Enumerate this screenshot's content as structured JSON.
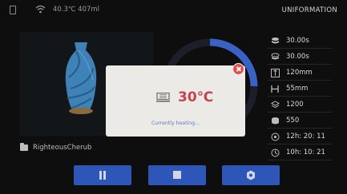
{
  "status_bar": {
    "status_text": "40.3℃ 407ml",
    "logo": "UNIFORMATION"
  },
  "stats": [
    {
      "icon": "layer-time-icon",
      "value": "30.00s"
    },
    {
      "icon": "layer-time-icon",
      "value": "30.00s"
    },
    {
      "icon": "height-icon",
      "value": "120mm"
    },
    {
      "icon": "width-icon",
      "value": "55mm"
    },
    {
      "icon": "layers-icon",
      "value": "1200"
    },
    {
      "icon": "resin-icon",
      "value": "550"
    },
    {
      "icon": "clock-icon",
      "value": "12h: 20: 11"
    },
    {
      "icon": "clock-icon",
      "value": "10h: 10: 21"
    }
  ],
  "file": {
    "name": "RighteousCherub"
  },
  "dialog": {
    "temperature": "30℃",
    "message": "Currently heating..."
  },
  "colors": {
    "accent": "#2e56b8",
    "temperature": "#c2454f",
    "close": "#e14e4e",
    "model": "#4a8fc4"
  }
}
